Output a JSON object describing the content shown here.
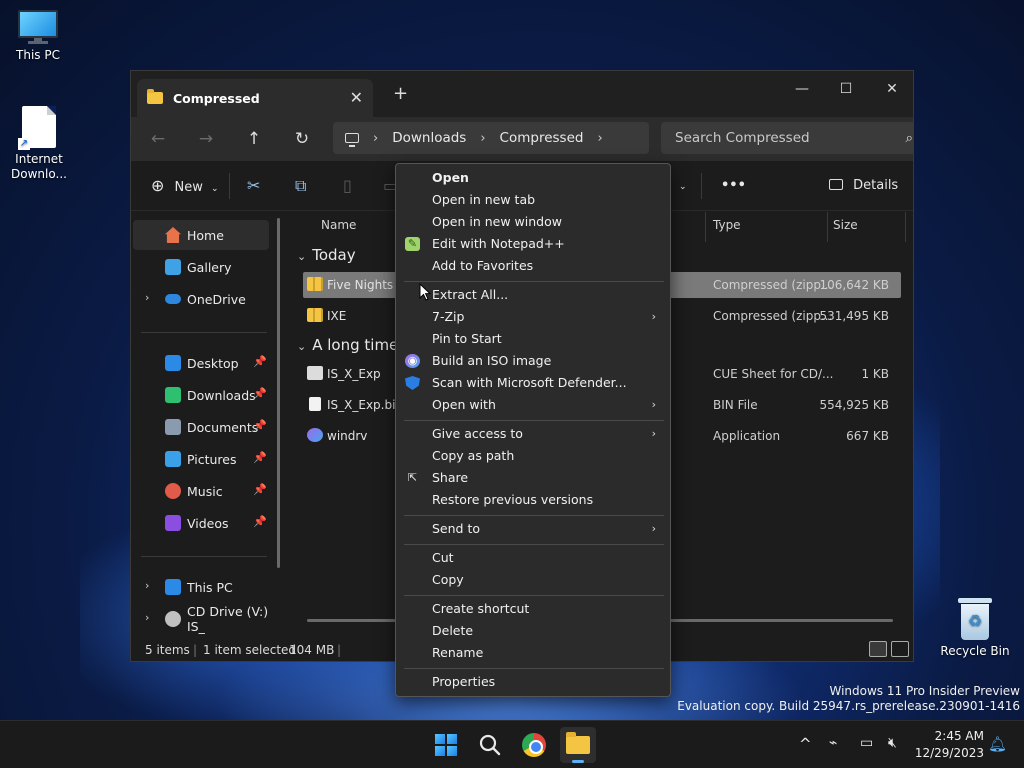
{
  "desktop": {
    "icons": [
      {
        "label": "This PC"
      },
      {
        "label": "Internet Downlo..."
      },
      {
        "label": "Recycle Bin"
      }
    ],
    "watermark": {
      "line1": "Windows 11 Pro Insider Preview",
      "line2": "Evaluation copy. Build 25947.rs_prerelease.230901-1416"
    }
  },
  "window": {
    "tab_title": "Compressed",
    "tab_close": "✕",
    "new_tab": "+",
    "controls": {
      "minimize": "—",
      "maximize": "☐",
      "close": "✕"
    },
    "nav": {
      "back": "←",
      "forward": "→",
      "up": "↑",
      "refresh": "↻"
    },
    "breadcrumb": [
      "Downloads",
      "Compressed"
    ],
    "search_placeholder": "Search Compressed",
    "commands": {
      "new_label": "New",
      "more": "•••",
      "details_label": "Details"
    },
    "sidebar": {
      "items": [
        {
          "label": "Home",
          "icon": "home-icon",
          "color": "#e8734a"
        },
        {
          "label": "Gallery",
          "icon": "gallery-icon",
          "color": "#3fa2e6"
        },
        {
          "label": "OneDrive",
          "icon": "onedrive-icon",
          "color": "#2e86de"
        },
        {
          "label": "Desktop",
          "icon": "desktop-icon",
          "color": "#2b8ae6"
        },
        {
          "label": "Downloads",
          "icon": "download-icon",
          "color": "#2fbf71"
        },
        {
          "label": "Documents",
          "icon": "documents-icon",
          "color": "#8a9bb0"
        },
        {
          "label": "Pictures",
          "icon": "pictures-icon",
          "color": "#3aa0e8"
        },
        {
          "label": "Music",
          "icon": "music-icon",
          "color": "#e25b4a"
        },
        {
          "label": "Videos",
          "icon": "videos-icon",
          "color": "#8a4fe0"
        },
        {
          "label": "This PC",
          "icon": "pc-icon",
          "color": "#2b8ae6"
        },
        {
          "label": "CD Drive (V:) IS_",
          "icon": "cd-drive-icon",
          "color": "#c0c0c0"
        }
      ]
    },
    "columns": {
      "name": "Name",
      "type": "Type",
      "size": "Size"
    },
    "groups": {
      "today": "Today",
      "long_time": "A long time"
    },
    "files": [
      {
        "name": "Five Nights A",
        "type": "Compressed (zipp...",
        "size": "106,642 KB",
        "selected": true
      },
      {
        "name": "IXE",
        "type": "Compressed (zipp...",
        "size": "531,495 KB"
      },
      {
        "name": "IS_X_Exp",
        "type": "CUE Sheet for CD/...",
        "size": "1 KB"
      },
      {
        "name": "IS_X_Exp.bin",
        "type": "BIN File",
        "size": "554,925 KB"
      },
      {
        "name": "windrv",
        "type": "Application",
        "size": "667 KB"
      }
    ],
    "status": {
      "count": "5 items",
      "selected": "1 item selected",
      "size": "104 MB"
    }
  },
  "context_menu": {
    "items": [
      {
        "label": "Open",
        "bold": true
      },
      {
        "label": "Open in new tab"
      },
      {
        "label": "Open in new window"
      },
      {
        "label": "Edit with Notepad++",
        "icon": "notepadpp-icon"
      },
      {
        "label": "Add to Favorites"
      },
      {
        "label": "Extract All..."
      },
      {
        "label": "7-Zip",
        "submenu": true
      },
      {
        "label": "Pin to Start"
      },
      {
        "label": "Build an ISO image",
        "icon": "iso-builder-icon"
      },
      {
        "label": "Scan with Microsoft Defender...",
        "icon": "defender-shield-icon"
      },
      {
        "label": "Open with",
        "submenu": true
      },
      {
        "label": "Give access to",
        "submenu": true
      },
      {
        "label": "Copy as path"
      },
      {
        "label": "Share",
        "icon": "share-icon"
      },
      {
        "label": "Restore previous versions"
      },
      {
        "label": "Send to",
        "submenu": true
      },
      {
        "label": "Cut"
      },
      {
        "label": "Copy"
      },
      {
        "label": "Create shortcut"
      },
      {
        "label": "Delete"
      },
      {
        "label": "Rename"
      },
      {
        "label": "Properties"
      }
    ],
    "submenu_arrow": "›"
  },
  "taskbar": {
    "time": "2:45 AM",
    "date": "12/29/2023",
    "tray_chevron": "^",
    "accent_color": "#5ab1f5"
  }
}
